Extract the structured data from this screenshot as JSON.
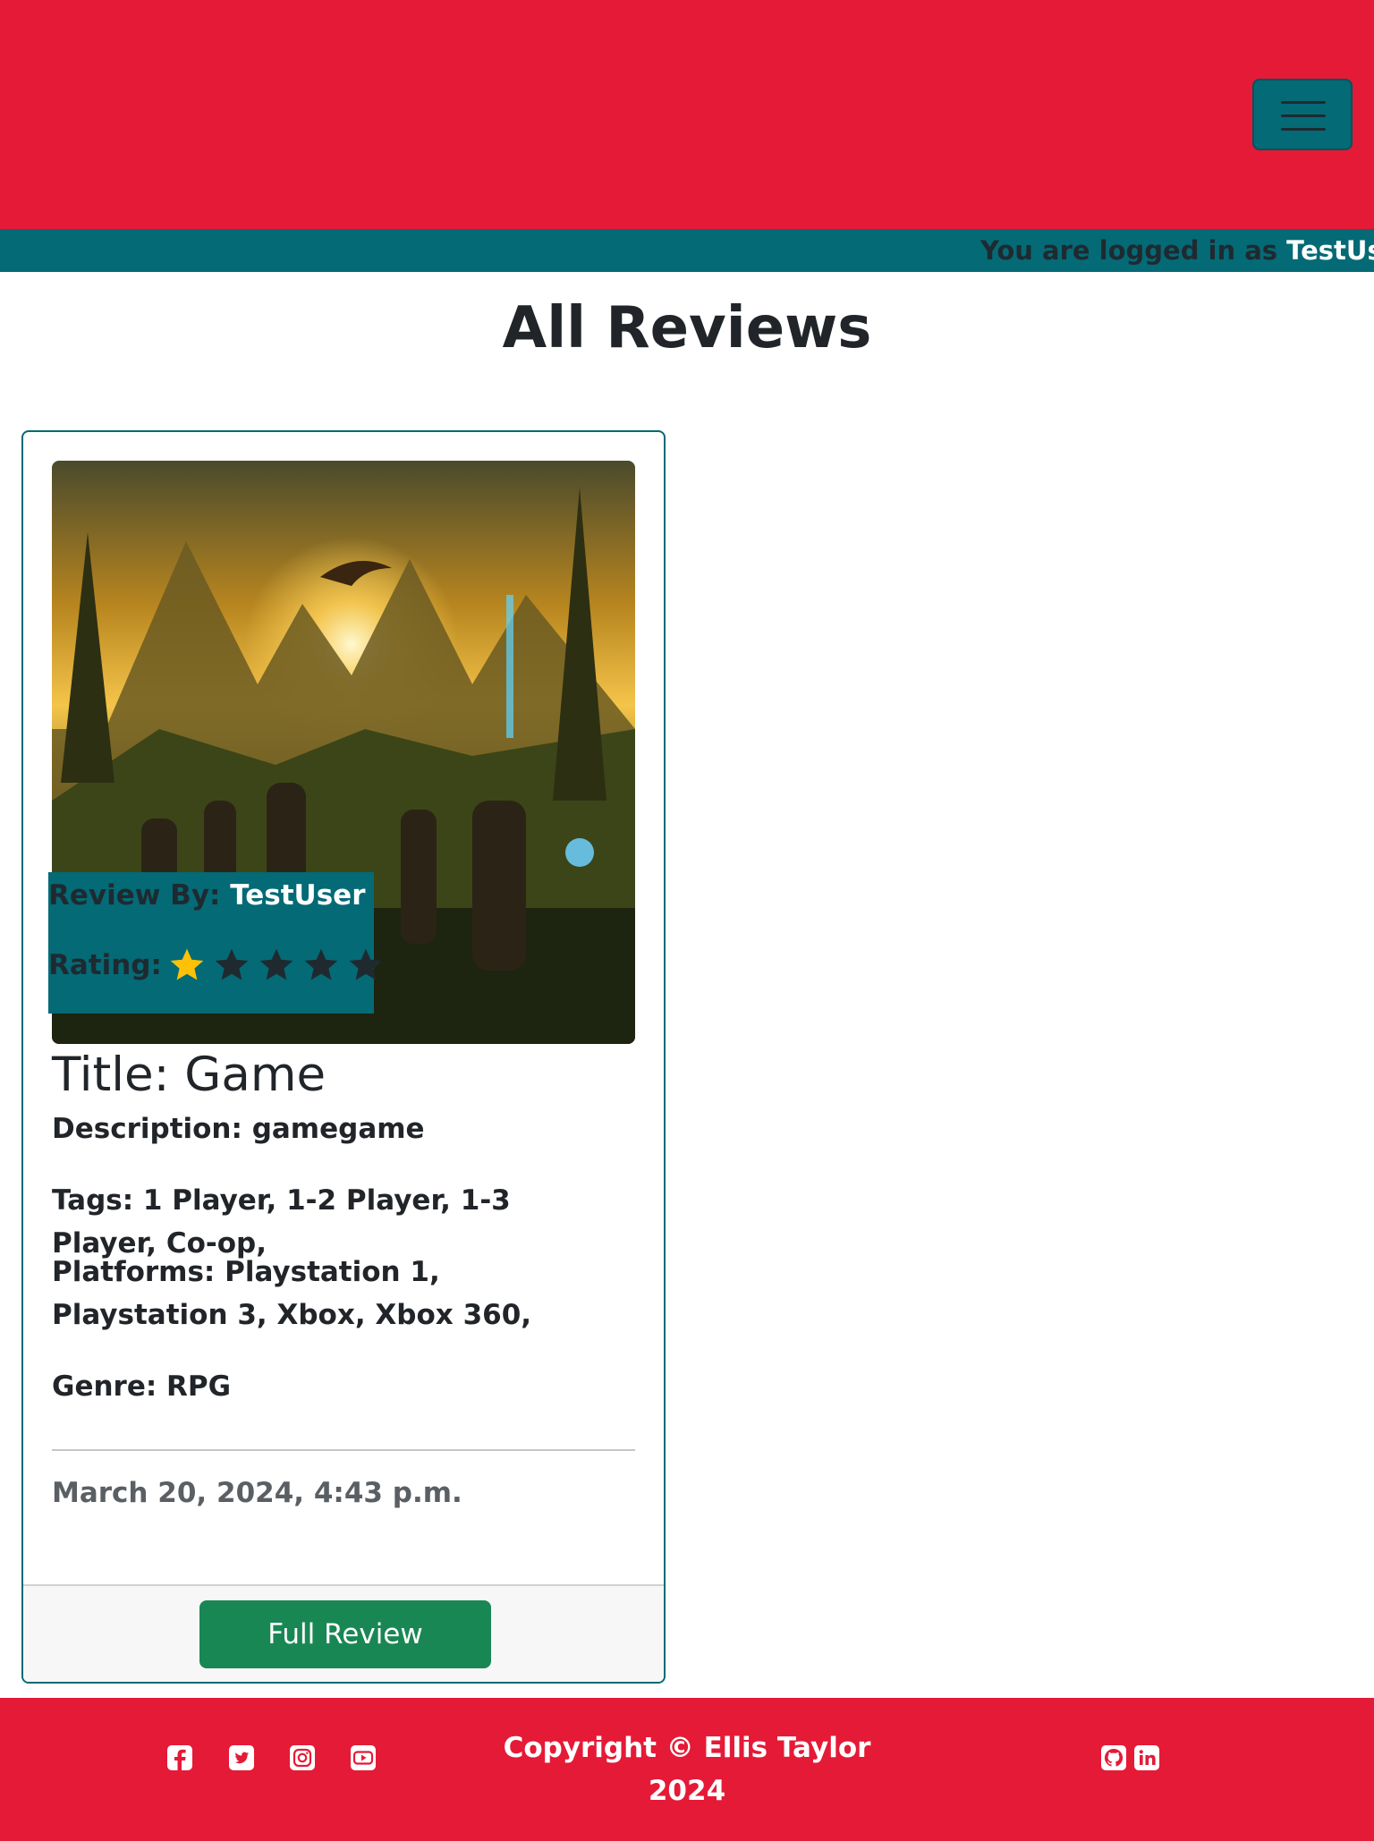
{
  "header": {
    "menu_icon": "hamburger-icon"
  },
  "login_bar": {
    "prefix": "You are logged in as",
    "username": "TestUser"
  },
  "page": {
    "title": "All Reviews"
  },
  "review_card": {
    "image_alt": "fantasy-game-art",
    "review_by_label": "Review By:",
    "reviewer": "TestUser",
    "rating_label": "Rating:",
    "rating": 1,
    "rating_max": 5,
    "title": "Title: Game",
    "description": "Description: gamegame",
    "tags": "Tags: 1 Player, 1-2 Player, 1-3 Player, Co-op,",
    "platforms": "Platforms: Playstation 1, Playstation 3, Xbox, Xbox 360,",
    "genre": "Genre: RPG",
    "date": "March 20, 2024, 4:43 p.m.",
    "button_label": "Full Review"
  },
  "footer": {
    "copyright_line1": "Copyright © Ellis Taylor",
    "copyright_line2": "2024",
    "social_icons": [
      "facebook-icon",
      "twitter-icon",
      "instagram-icon",
      "youtube-icon"
    ],
    "profile_icons": [
      "github-icon",
      "linkedin-icon"
    ]
  },
  "colors": {
    "brand_red": "#e51a36",
    "teal": "#046a76",
    "button_green": "#198754",
    "star_active": "#ffc107",
    "star_inactive": "#1f2a30"
  }
}
